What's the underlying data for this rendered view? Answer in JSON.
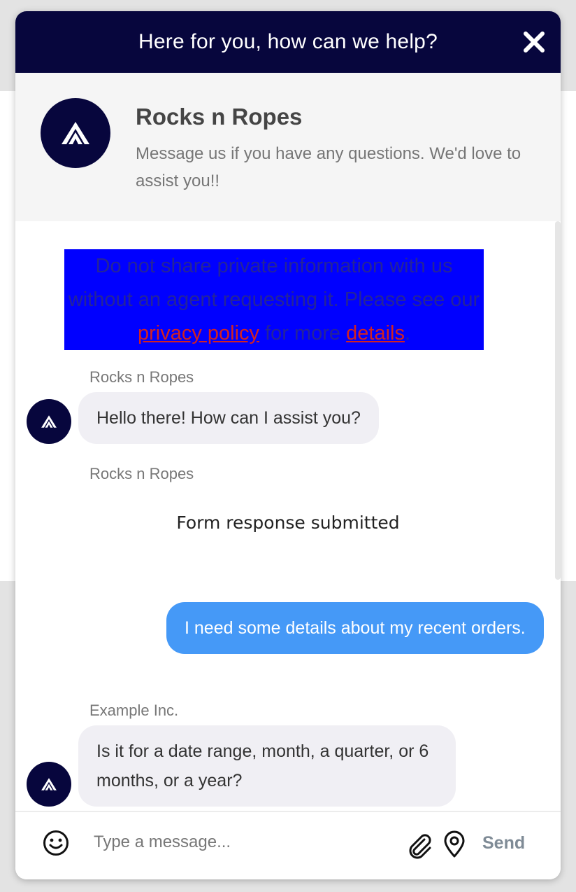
{
  "header": {
    "title": "Here for you, how can we help?",
    "close_icon": "close-icon"
  },
  "brand": {
    "name": "Rocks n Ropes",
    "description": "Message us if you have any questions. We'd love to assist you!!",
    "logo_icon": "mountain-logo-icon"
  },
  "privacy_notice": {
    "text_before": "Do not share private information with us without an agent requesting it. Please see our ",
    "privacy_link": "privacy policy",
    "text_middle": " for more ",
    "details_link": "details",
    "text_after": "."
  },
  "messages": [
    {
      "sender": "Rocks n Ropes",
      "text": "Hello there! How can I assist you?",
      "direction": "incoming"
    },
    {
      "sender": "Rocks n Ropes",
      "text": "Form response submitted",
      "direction": "system"
    },
    {
      "sender": "",
      "text": "I need some details about my recent orders.",
      "direction": "outgoing"
    },
    {
      "sender": "Example Inc.",
      "text": "Is it for a date range, month, a quarter, or 6 months, or a year?",
      "direction": "incoming"
    }
  ],
  "composer": {
    "placeholder": "Type a message...",
    "send_label": "Send",
    "icons": [
      "emoji-icon",
      "paperclip-icon",
      "location-pin-icon"
    ]
  },
  "colors": {
    "header_bg": "#07063d",
    "outgoing_bubble": "#4599f7",
    "incoming_bubble": "#f0eff4",
    "notice_bg": "#0000ff",
    "link": "#d12222"
  }
}
